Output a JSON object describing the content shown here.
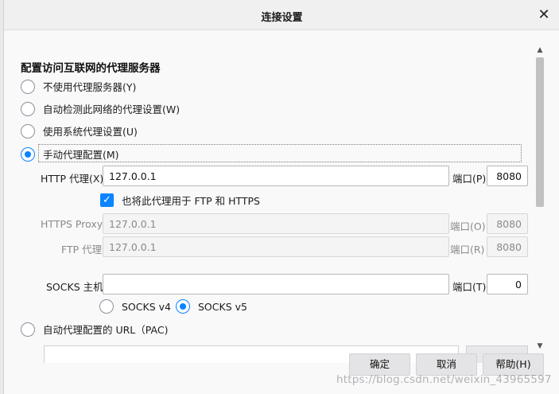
{
  "dialog": {
    "title": "连接设置",
    "close_glyph": "✕",
    "heading": "配置访问互联网的代理服务器",
    "options": {
      "no_proxy": "不使用代理服务器(Y)",
      "auto_detect": "自动检测此网络的代理设置(W)",
      "system_proxy": "使用系统代理设置(U)",
      "manual_proxy": "手动代理配置(M)",
      "pac_url": "自动代理配置的 URL（PAC)"
    },
    "selected_option": "manual_proxy",
    "http": {
      "label": "HTTP 代理(X)",
      "host": "127.0.0.1",
      "port_label": "端口(P)",
      "port": "8080"
    },
    "also_use": {
      "label": "也将此代理用于 FTP 和 HTTPS",
      "checked": true,
      "check_glyph": "✓"
    },
    "https": {
      "label": "HTTPS Proxy",
      "host": "127.0.0.1",
      "port_label": "端口(O)",
      "port": "8080"
    },
    "ftp": {
      "label": "FTP 代理",
      "host": "127.0.0.1",
      "port_label": "端口(R)",
      "port": "8080"
    },
    "socks": {
      "label": "SOCKS 主机",
      "host": "",
      "port_label": "端口(T)",
      "port": "0",
      "v4_label": "SOCKS v4",
      "v5_label": "SOCKS v5",
      "selected_version": "v5"
    },
    "scroll": {
      "up_glyph": "▲",
      "down_glyph": "▼"
    },
    "buttons": {
      "ok": "确定",
      "cancel": "取消",
      "help": "帮助(H)"
    }
  },
  "watermark": "https://blog.csdn.net/weixin_43965597",
  "colors": {
    "accent": "#0a84ff",
    "dialog_bg": "#f9f9fa",
    "title_bg": "#f0f0f1"
  }
}
